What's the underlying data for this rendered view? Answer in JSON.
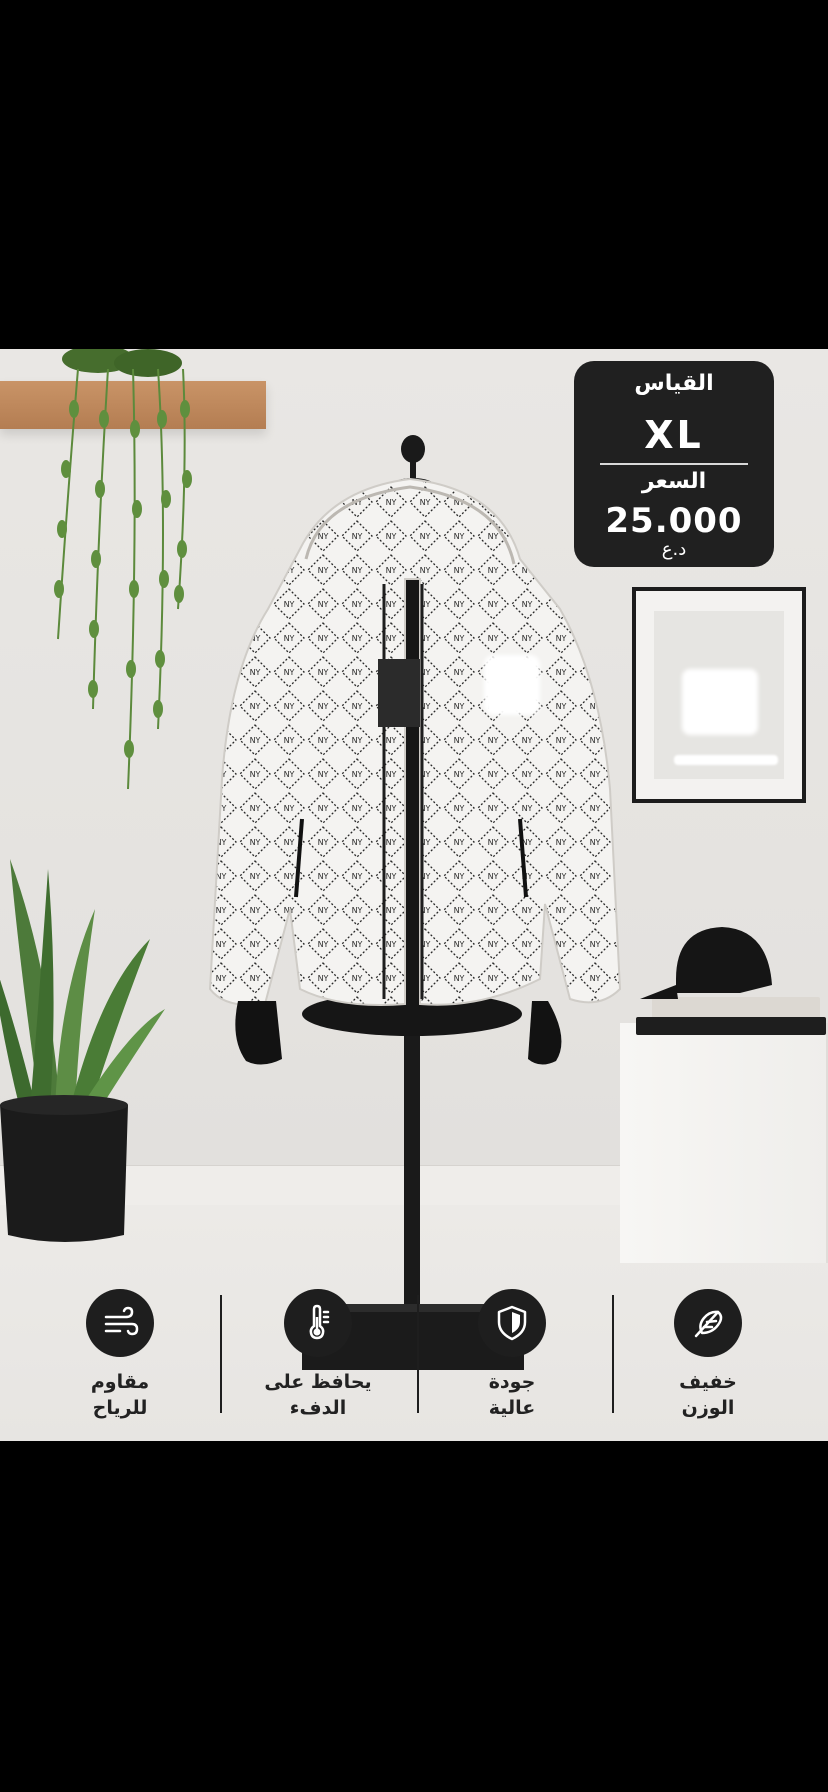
{
  "product_card": {
    "size_label": "القياس",
    "size_value": "XL",
    "price_label": "السعر",
    "price_value": "25.000",
    "currency": "د.ع"
  },
  "features": [
    {
      "icon": "wind-icon",
      "line1": "مقاوم",
      "line2": "للرياح"
    },
    {
      "icon": "thermometer-icon",
      "line1": "يحافظ على",
      "line2": "الدفء"
    },
    {
      "icon": "shield-icon",
      "line1": "جودة",
      "line2": "عالية"
    },
    {
      "icon": "feather-icon",
      "line1": "خفيف",
      "line2": "الوزن"
    }
  ],
  "colors": {
    "card_background": "#202020",
    "icon_background": "#1e1e1e",
    "wall": "#e6e4e1",
    "shelf_wood": "#b47d52"
  }
}
